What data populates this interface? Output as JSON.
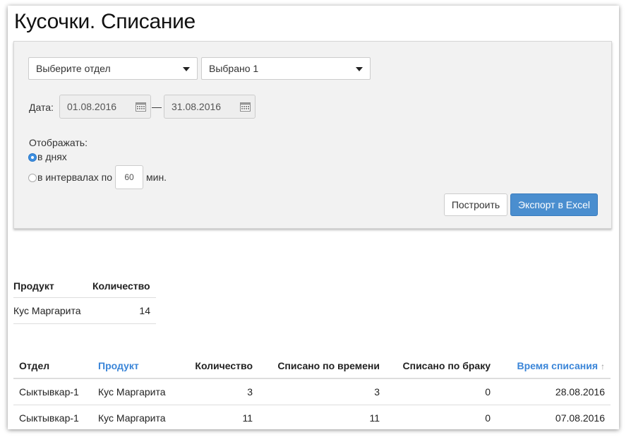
{
  "page": {
    "title": "Кусочки. Списание"
  },
  "filters": {
    "department_select": {
      "value": "Выберите отдел"
    },
    "product_select": {
      "value": "Выбрано 1"
    },
    "date_label": "Дата:",
    "date_from": "01.08.2016",
    "date_separator": "—",
    "date_to": "31.08.2016",
    "display_label": "Отображать:",
    "mode_days": {
      "label": "в днях",
      "checked": true
    },
    "mode_intervals": {
      "label": "в интервалах по",
      "checked": false
    },
    "interval_value": "60",
    "interval_unit": "мин.",
    "build_button": "Построить",
    "export_button": "Экспорт в Excel"
  },
  "summary_table": {
    "columns": [
      "Продукт",
      "Количество"
    ],
    "rows": [
      [
        "Кус Маргарита",
        "14"
      ]
    ]
  },
  "detail_table": {
    "columns": [
      "Отдел",
      "Продукт",
      "Количество",
      "Списано по времени",
      "Списано по браку",
      "Время списания"
    ],
    "sort_indicator": "↑",
    "rows": [
      [
        "Сыктывкар-1",
        "Кус Маргарита",
        "3",
        "3",
        "0",
        "28.08.2016"
      ],
      [
        "Сыктывкар-1",
        "Кус Маргарита",
        "11",
        "11",
        "0",
        "07.08.2016"
      ]
    ]
  },
  "colors": {
    "accent": "#3a85d8",
    "primary_button": "#4a8ecf",
    "panel_bg": "#f2f2f2"
  }
}
